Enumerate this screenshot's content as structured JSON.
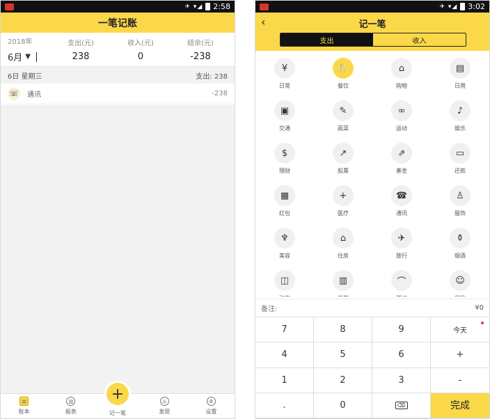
{
  "left": {
    "status": {
      "time": "2:58",
      "icons": "✈ ▾◢"
    },
    "title": "一笔记账",
    "summary": {
      "year": "2018年",
      "month": "6月",
      "expense_label": "支出(元)",
      "expense_value": "238",
      "income_label": "收入(元)",
      "income_value": "0",
      "balance_label": "结余(元)",
      "balance_value": "-238"
    },
    "day": {
      "date": "6日 星期三",
      "total": "支出: 238"
    },
    "entries": [
      {
        "name": "通讯",
        "amount": "-238",
        "icon": "phone-icon"
      }
    ],
    "tabs": [
      {
        "label": "账本",
        "icon": "ledger-icon"
      },
      {
        "label": "报表",
        "icon": "report-icon"
      },
      {
        "label": "记一笔",
        "icon": "plus-icon"
      },
      {
        "label": "发现",
        "icon": "discover-icon"
      },
      {
        "label": "设置",
        "icon": "gear-icon"
      }
    ],
    "accent": "#fbd84a"
  },
  "right": {
    "status": {
      "time": "3:02",
      "icons": "✈ ▾◢"
    },
    "title": "记一笔",
    "back": "‹",
    "seg": {
      "expense": "支出",
      "income": "收入"
    },
    "categories": [
      {
        "label": "日常",
        "glyph": "¥"
      },
      {
        "label": "餐饮",
        "glyph": "🍴",
        "selected": true
      },
      {
        "label": "购物",
        "glyph": "⌂"
      },
      {
        "label": "日用",
        "glyph": "▤"
      },
      {
        "label": "交通",
        "glyph": "▣"
      },
      {
        "label": "蔬菜",
        "glyph": "✎"
      },
      {
        "label": "运动",
        "glyph": "∞"
      },
      {
        "label": "娱乐",
        "glyph": "♪"
      },
      {
        "label": "理财",
        "glyph": "$"
      },
      {
        "label": "股票",
        "glyph": "↗"
      },
      {
        "label": "基金",
        "glyph": "⇗"
      },
      {
        "label": "还款",
        "glyph": "▭"
      },
      {
        "label": "红包",
        "glyph": "▦"
      },
      {
        "label": "医疗",
        "glyph": "+"
      },
      {
        "label": "通讯",
        "glyph": "☎"
      },
      {
        "label": "服饰",
        "glyph": "♙"
      },
      {
        "label": "美容",
        "glyph": "♆"
      },
      {
        "label": "住房",
        "glyph": "⌂"
      },
      {
        "label": "旅行",
        "glyph": "✈"
      },
      {
        "label": "烟酒",
        "glyph": "⚱"
      },
      {
        "label": "汽车",
        "glyph": "◫"
      },
      {
        "label": "书籍",
        "glyph": "▥"
      },
      {
        "label": "学习",
        "glyph": "⌒"
      },
      {
        "label": "宠物",
        "glyph": "☺"
      }
    ],
    "note_label": "备注:",
    "amount": "¥0",
    "keys": [
      "7",
      "8",
      "9",
      "今天",
      "4",
      "5",
      "6",
      "+",
      "1",
      "2",
      "3",
      "-",
      ".",
      "0",
      "⌫",
      "完成"
    ]
  }
}
